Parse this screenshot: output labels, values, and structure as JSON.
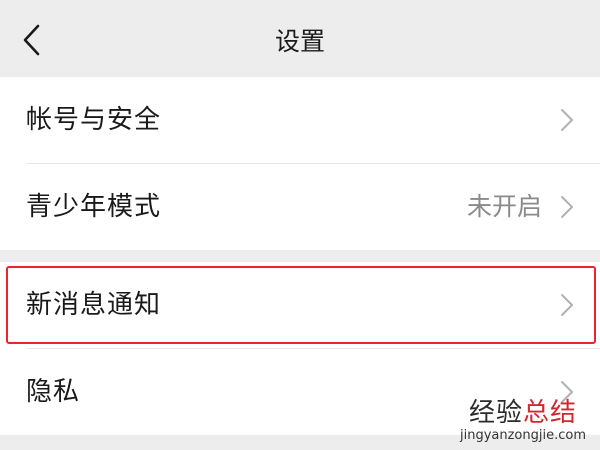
{
  "header": {
    "title": "设置",
    "back_icon": "chevron-left-icon"
  },
  "groups": [
    {
      "items": [
        {
          "label": "帐号与安全",
          "value": ""
        },
        {
          "label": "青少年模式",
          "value": "未开启"
        }
      ]
    },
    {
      "items": [
        {
          "label": "新消息通知",
          "value": ""
        },
        {
          "label": "隐私",
          "value": ""
        }
      ]
    }
  ],
  "highlight": {
    "item": "新消息通知",
    "color": "#e8262e"
  },
  "watermark": {
    "char1": "经",
    "char2": "验",
    "char3": "总",
    "char4": "结",
    "url": "jingyanzongjie.com"
  },
  "colors": {
    "background": "#ededed",
    "card": "#ffffff",
    "text": "#1a1a1a",
    "secondary_text": "#8a8a8a",
    "chevron": "#b2b2b2"
  }
}
